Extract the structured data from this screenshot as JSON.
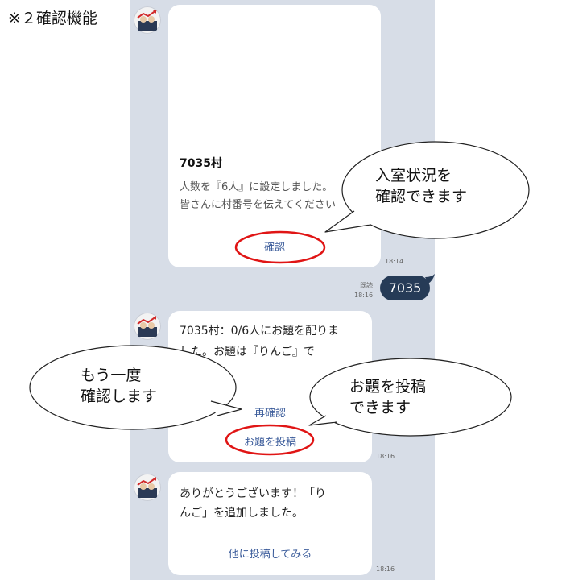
{
  "page": {
    "caption": "※２確認機能"
  },
  "messages": {
    "card1": {
      "title": "7035村",
      "line1": "人数を『6人』に設定しました。",
      "line2": "皆さんに村番号を伝えてください",
      "confirm_button": "確認",
      "time": "18:14"
    },
    "user": {
      "text": "7035",
      "read_label": "既読",
      "time": "18:16"
    },
    "card2": {
      "line1": "7035村：0/6人にお題を配りま",
      "line2": "した。お題は『りんご』で",
      "reconfirm_button": "再確認",
      "post_button": "お題を投稿",
      "time": "18:16"
    },
    "card3": {
      "line1": "ありがとうございます！「り",
      "line2": "んご」を追加しました。",
      "post_other_button": "他に投稿してみる",
      "time": "18:16"
    }
  },
  "annotations": {
    "callout_room": [
      "入室状況を",
      "確認できます"
    ],
    "callout_again": [
      "もう一度",
      "確認します"
    ],
    "callout_post": [
      "お題を投稿",
      "できます"
    ]
  },
  "colors": {
    "chat_background": "#d7dde7",
    "link": "#3a5b9a",
    "user_bubble": "#263b57",
    "highlight_ring": "#e01515"
  }
}
